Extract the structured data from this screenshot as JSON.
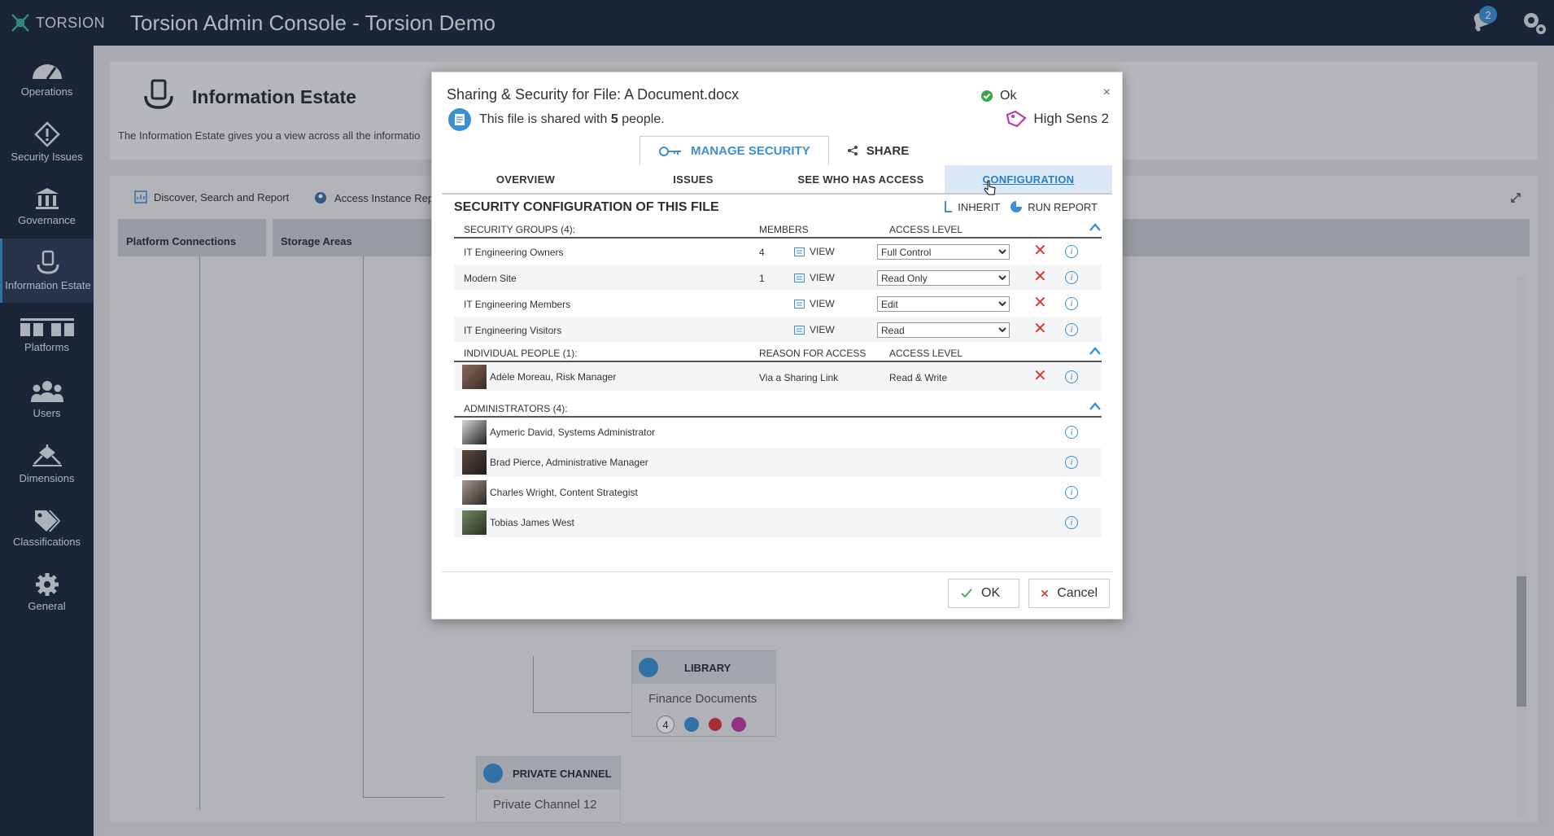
{
  "app": {
    "brand": "TORSION",
    "title": "Torsion Admin Console - Torsion Demo",
    "notification_count": "2"
  },
  "sidebar": {
    "items": [
      {
        "label": "Operations",
        "icon": "speedometer-icon"
      },
      {
        "label": "Security Issues",
        "icon": "diamond-alert-icon"
      },
      {
        "label": "Governance",
        "icon": "building-columns-icon"
      },
      {
        "label": "Information Estate",
        "icon": "hand-holding-file-icon"
      },
      {
        "label": "Platforms",
        "icon": "platforms-icon"
      },
      {
        "label": "Users",
        "icon": "users-icon"
      },
      {
        "label": "Dimensions",
        "icon": "dimensions-icon"
      },
      {
        "label": "Classifications",
        "icon": "tags-icon"
      },
      {
        "label": "General",
        "icon": "gear-icon"
      }
    ]
  },
  "page": {
    "title": "Information Estate",
    "description": "The Information Estate gives you a view across all the informatio",
    "toolbar": {
      "discover": "Discover, Search and Report",
      "access": "Access Instance Rep"
    },
    "columns": [
      "Platform Connections",
      "Storage Areas"
    ],
    "library_node": {
      "label": "LIBRARY",
      "name": "Finance Documents",
      "count": "4"
    },
    "channel_node": {
      "label": "PRIVATE CHANNEL",
      "name": "Private Channel 12"
    }
  },
  "dialog": {
    "title": "Sharing & Security for File: A Document.docx",
    "shared_prefix": "This file is shared with ",
    "shared_count": "5",
    "shared_suffix": " people.",
    "status": "Ok",
    "sensitivity": "High Sens 2",
    "close": "×",
    "main_tabs": [
      "MANAGE SECURITY",
      "SHARE"
    ],
    "sub_tabs": [
      "OVERVIEW",
      "ISSUES",
      "SEE WHO HAS ACCESS",
      "CONFIGURATION"
    ],
    "config_title": "SECURITY CONFIGURATION OF THIS FILE",
    "inherit": "INHERIT",
    "run_report": "RUN REPORT",
    "groups": {
      "header": "SECURITY GROUPS (4):",
      "members_header": "MEMBERS",
      "access_header": "ACCESS LEVEL",
      "view_label": "VIEW",
      "rows": [
        {
          "name": "IT Engineering Owners",
          "members": "4",
          "access": "Full Control"
        },
        {
          "name": "Modern Site",
          "members": "1",
          "access": "Read Only"
        },
        {
          "name": "IT Engineering Members",
          "members": "",
          "access": "Edit"
        },
        {
          "name": "IT Engineering Visitors",
          "members": "",
          "access": "Read"
        }
      ]
    },
    "people": {
      "header": "INDIVIDUAL PEOPLE (1):",
      "reason_header": "REASON FOR ACCESS",
      "access_header": "ACCESS LEVEL",
      "rows": [
        {
          "name": "Adèle Moreau, Risk Manager",
          "reason": "Via a Sharing Link",
          "access": "Read & Write"
        }
      ]
    },
    "admins": {
      "header": "ADMINISTRATORS (4):",
      "rows": [
        {
          "name": "Aymeric David, Systems Administrator"
        },
        {
          "name": "Brad Pierce, Administrative Manager"
        },
        {
          "name": "Charles Wright, Content Strategist"
        },
        {
          "name": "Tobias James West"
        }
      ]
    },
    "ok_label": "OK",
    "cancel_label": "Cancel"
  }
}
